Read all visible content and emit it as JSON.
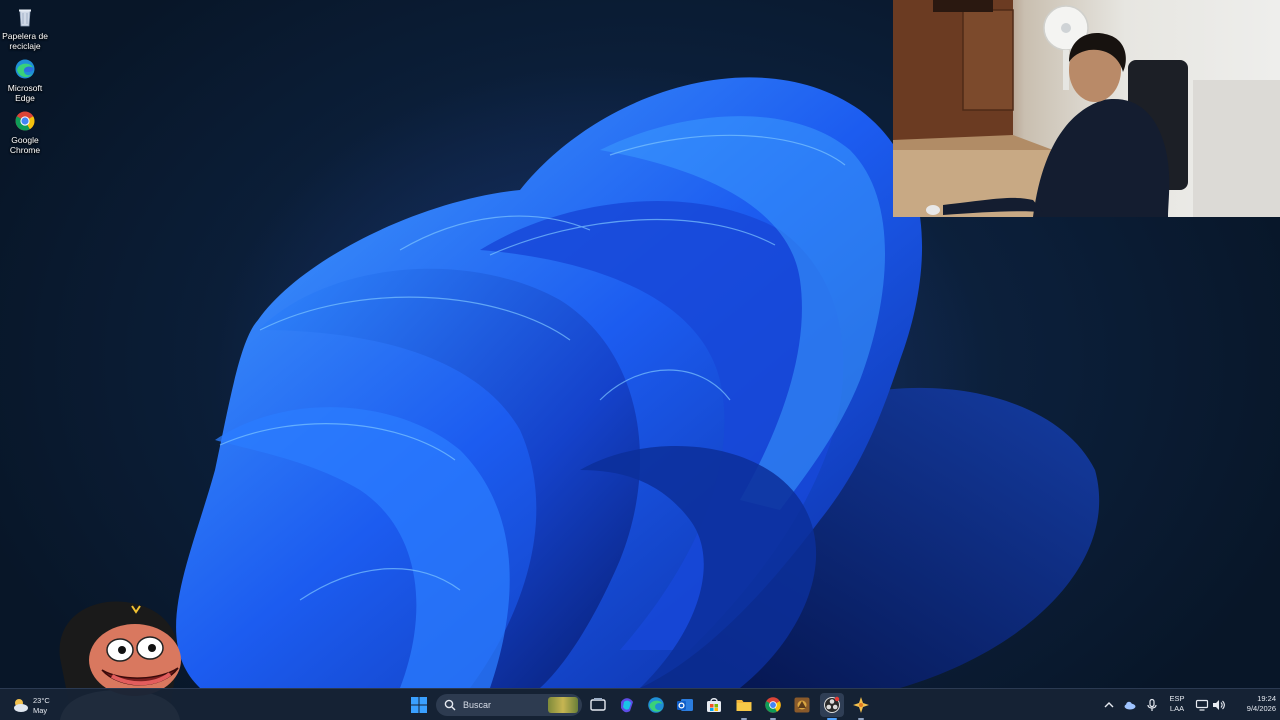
{
  "desktop": {
    "icons": [
      {
        "label": "Papelera de reciclaje",
        "icon": "recycle-bin-icon"
      },
      {
        "label": "Microsoft Edge",
        "icon": "edge-icon"
      },
      {
        "label": "Google Chrome",
        "icon": "chrome-icon"
      }
    ]
  },
  "weather": {
    "temp": "23°C",
    "text": "May"
  },
  "taskbar": {
    "search_placeholder": "Buscar",
    "apps": [
      "start-icon",
      "task-view-icon",
      "m365-copilot-icon",
      "edge-icon",
      "outlook-icon",
      "store-icon",
      "file-explorer-icon",
      "chrome-icon",
      "game-app-icon",
      "obs-icon",
      "sparkle-app-icon"
    ]
  },
  "tray": {
    "language_line1": "ESP",
    "language_line2": "LAA",
    "time": "19:24",
    "date": "9/4/2026"
  },
  "colors": {
    "accent": "#1f6bff",
    "taskbar": "#162234"
  }
}
